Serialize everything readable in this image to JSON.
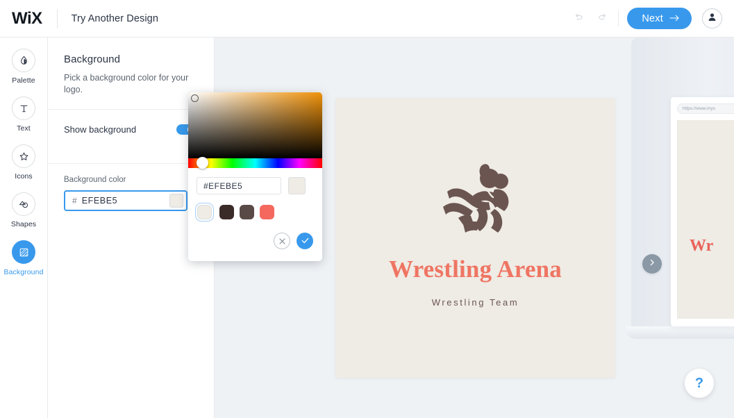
{
  "topbar": {
    "brand": "WiX",
    "try_another": "Try Another Design",
    "undo_icon": "undo-arrow-icon",
    "redo_icon": "redo-arrow-icon",
    "next_label": "Next",
    "next_arrow": "→",
    "avatar_icon": "user-avatar-icon",
    "accent_color": "#3899EC"
  },
  "sidebar": {
    "items": [
      {
        "label": "Palette",
        "icon": "droplet-icon",
        "active": false
      },
      {
        "label": "Text",
        "icon": "text-t-icon",
        "active": false
      },
      {
        "label": "Icons",
        "icon": "star-icon",
        "active": false
      },
      {
        "label": "Shapes",
        "icon": "shapes-icon",
        "active": false
      },
      {
        "label": "Background",
        "icon": "background-pattern-icon",
        "active": true
      }
    ]
  },
  "panel": {
    "title": "Background",
    "subtitle": "Pick a background color for your logo.",
    "toggle_label": "Show background",
    "toggle_on": true,
    "field_label": "Background color",
    "hash": "#",
    "hex_value": "EFEBE5",
    "swatch_color": "#EFEBE5"
  },
  "picker": {
    "hex_value": "#EFEBE5",
    "preview_color": "#EFEBE5",
    "hue_degrees": 35,
    "swatches": [
      {
        "color": "#EFEBE5",
        "selected": true
      },
      {
        "color": "#3B2B28",
        "selected": false
      },
      {
        "color": "#5A4A47",
        "selected": false
      },
      {
        "color": "#F4685E",
        "selected": false
      }
    ],
    "cancel_icon": "close-x-icon",
    "confirm_icon": "checkmark-icon"
  },
  "logo": {
    "name": "Wrestling Arena",
    "tagline": "Wrestling Team",
    "name_color": "#EF7563",
    "mark_color": "#6B5550",
    "background_color": "#EFEBE5",
    "mark_icon": "wrestler-figure-icon"
  },
  "canvas": {
    "background_color": "#EFF2F5",
    "next_arrow_icon": "chevron-right-icon",
    "help_label": "?"
  },
  "preview": {
    "url": "https://www.mys",
    "page_word": "Wr"
  }
}
